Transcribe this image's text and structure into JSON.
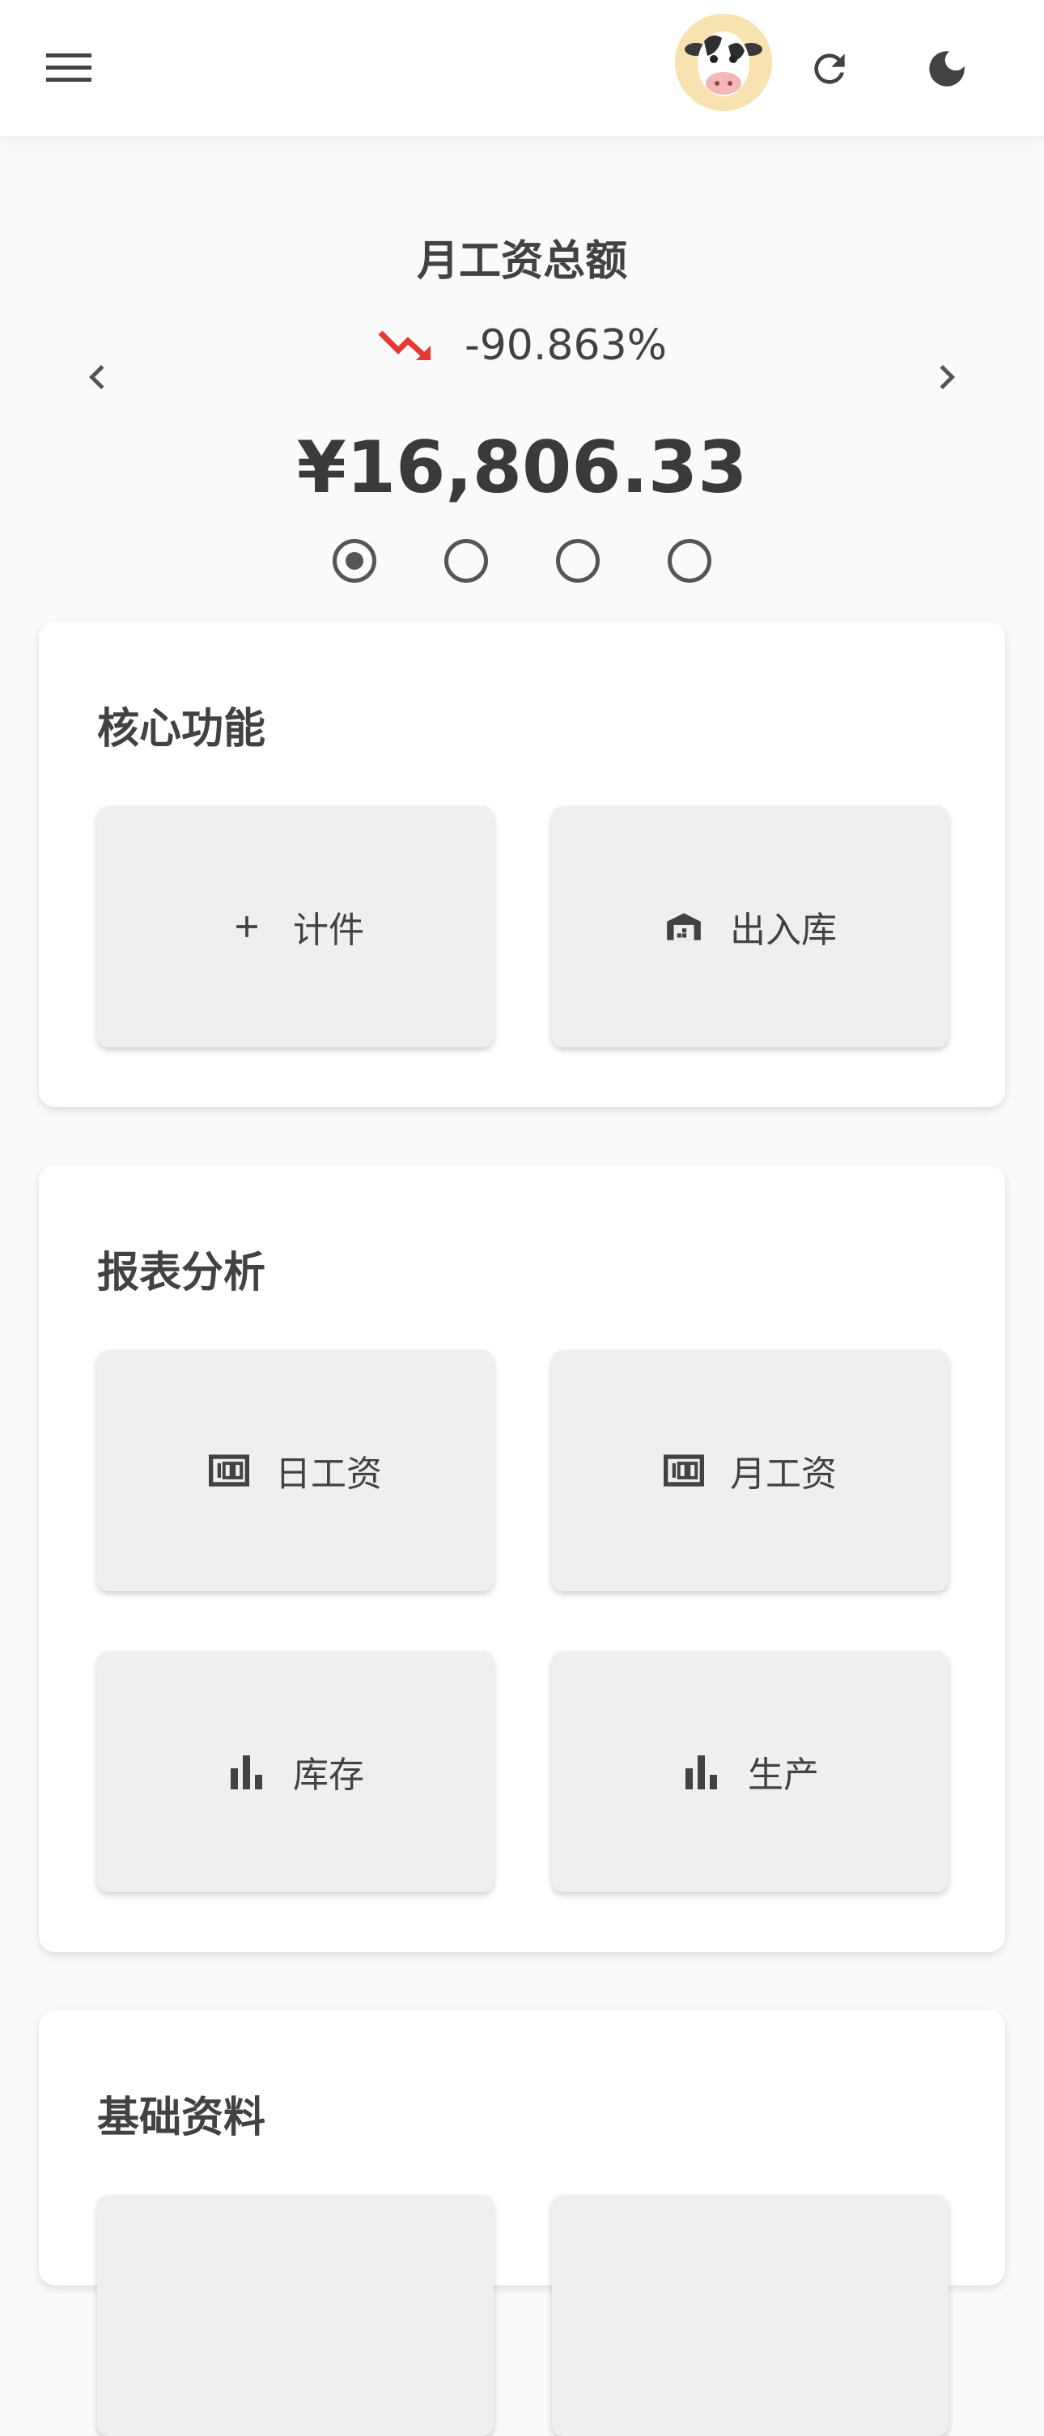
{
  "header": {
    "menu_icon": "menu-icon",
    "avatar_icon": "cow-avatar",
    "refresh_icon": "refresh-icon",
    "theme_icon": "moon-icon"
  },
  "summary": {
    "title": "月工资总额",
    "trend_icon": "trending-down-icon",
    "trend_color": "#e53935",
    "change": "-90.863%",
    "amount": "¥16,806.33",
    "pages": 4,
    "active_page": 1
  },
  "core": {
    "title": "核心功能",
    "tiles": [
      {
        "label": "计件",
        "icon": "plus-icon"
      },
      {
        "label": "出入库",
        "icon": "warehouse-icon"
      }
    ]
  },
  "reports": {
    "title": "报表分析",
    "tiles": [
      {
        "label": "日工资",
        "icon": "counter-icon"
      },
      {
        "label": "月工资",
        "icon": "counter-icon"
      },
      {
        "label": "库存",
        "icon": "bar-chart-icon"
      },
      {
        "label": "生产",
        "icon": "bar-chart-icon"
      }
    ]
  },
  "basics": {
    "title": "基础资料"
  }
}
